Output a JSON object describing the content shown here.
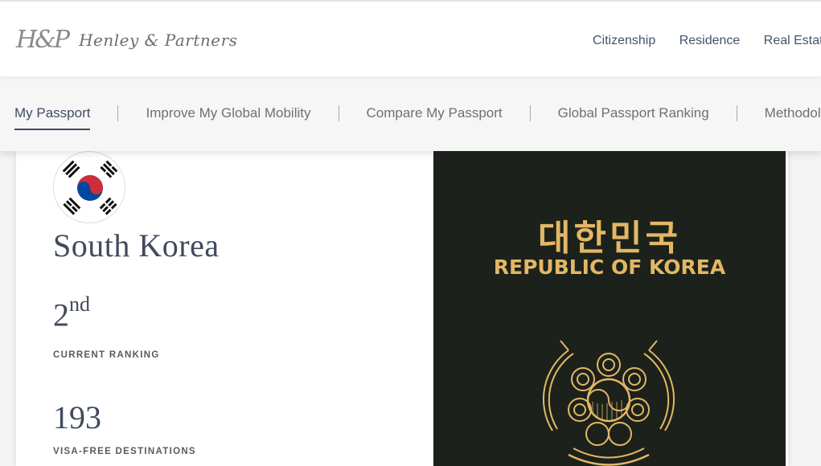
{
  "header": {
    "logo_mark": "H&P",
    "logo_name": "Henley & Partners",
    "nav": [
      "Citizenship",
      "Residence",
      "Real Estate"
    ]
  },
  "subnav": {
    "items": [
      {
        "label": "My Passport",
        "active": true
      },
      {
        "label": "Improve My Global Mobility",
        "active": false
      },
      {
        "label": "Compare My Passport",
        "active": false
      },
      {
        "label": "Global Passport Ranking",
        "active": false
      },
      {
        "label": "Methodology",
        "active": false
      }
    ]
  },
  "country": {
    "name": "South Korea",
    "rank_number": "2",
    "rank_suffix": "nd",
    "rank_label": "CURRENT RANKING",
    "visa_free_count": "193",
    "visa_free_label": "VISA-FREE DESTINATIONS"
  },
  "passport": {
    "title_korean": "대한민국",
    "title_english": "REPUBLIC OF KOREA",
    "emblem_icon": "korean-national-emblem-icon",
    "cover_color": "#1c221b",
    "text_color": "#e3b765"
  },
  "colors": {
    "accent": "#3f4d63",
    "flag_red": "#cd2e3a",
    "flag_blue": "#0047a0"
  }
}
